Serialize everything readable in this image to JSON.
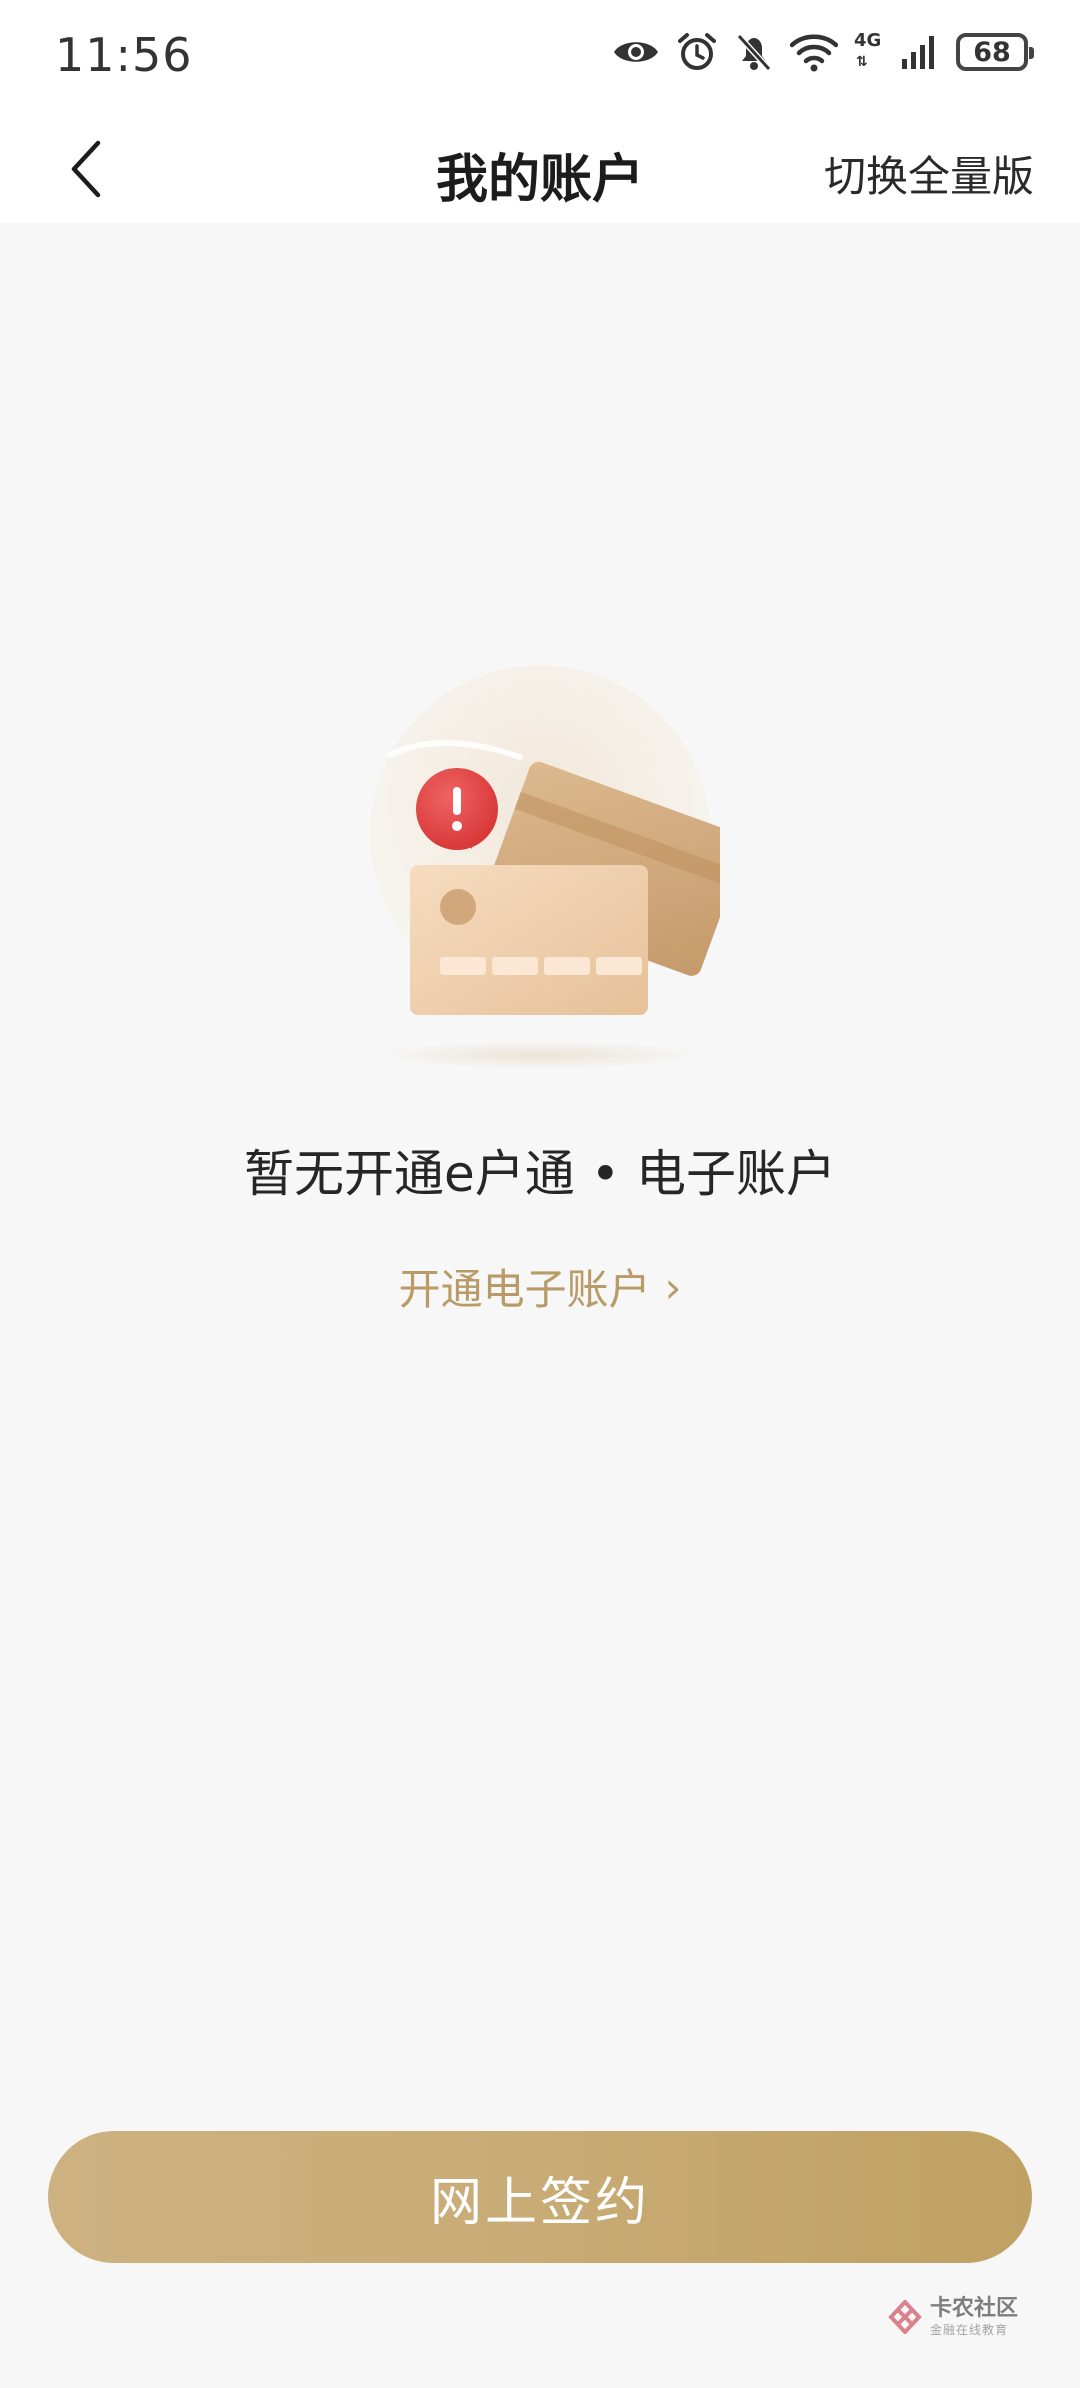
{
  "status_bar": {
    "time": "11:56",
    "network_label": "4G",
    "battery_level": "68",
    "icons": [
      "eye-icon",
      "alarm-icon",
      "mute-bell-icon",
      "wifi-icon",
      "signal-icon",
      "battery-icon"
    ]
  },
  "nav": {
    "title": "我的账户",
    "right_link": "切换全量版",
    "back_icon": "chevron-left-icon"
  },
  "empty_state": {
    "illustration": "cards-warning-illustration",
    "title": "暂无开通e户通 • 电子账户",
    "link_label": "开通电子账户",
    "link_chevron": "›"
  },
  "bottom_button": {
    "label": "网上签约"
  },
  "watermark": {
    "main": "卡农社区",
    "sub": "金融在线教育"
  },
  "colors": {
    "background": "#f7f7f7",
    "accent_gold": "#b89b66",
    "button_gold": "#c8ab75",
    "warning_red": "#e14b4b"
  }
}
